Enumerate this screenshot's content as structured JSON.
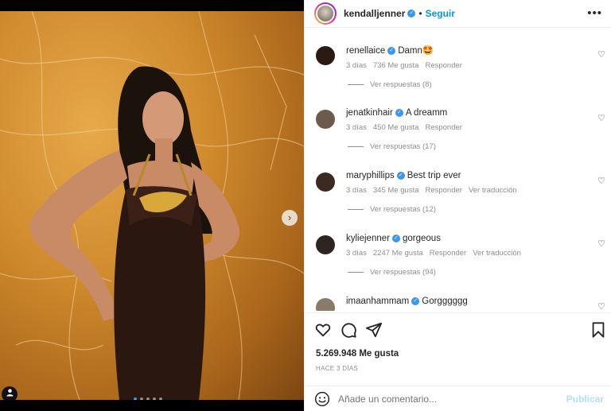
{
  "header": {
    "username": "kendalljenner",
    "separator": "•",
    "follow_label": "Seguir",
    "more_label": "•••"
  },
  "photo": {
    "next_arrow": "›",
    "user_tag_icon": "person-icon",
    "carousel_dots": 5,
    "carousel_active": 0
  },
  "comments": [
    {
      "user": "renellaice",
      "verified": true,
      "text": "Damn🤩",
      "age": "3 días",
      "likes": "736 Me gusta",
      "reply": "Responder",
      "translate": "",
      "replies": "Ver respuestas (8)",
      "avatar_color": "#2b1a14"
    },
    {
      "user": "jenatkinhair",
      "verified": true,
      "text": "A dreamm",
      "age": "3 días",
      "likes": "450 Me gusta",
      "reply": "Responder",
      "translate": "",
      "replies": "Ver respuestas (17)",
      "avatar_color": "#6d5a4d"
    },
    {
      "user": "maryphillips",
      "verified": true,
      "text": "Best trip ever",
      "age": "3 días",
      "likes": "345 Me gusta",
      "reply": "Responder",
      "translate": "Ver traducción",
      "replies": "Ver respuestas (12)",
      "avatar_color": "#3a2a22"
    },
    {
      "user": "kyliejenner",
      "verified": true,
      "text": "gorgeous",
      "age": "3 días",
      "likes": "2247 Me gusta",
      "reply": "Responder",
      "translate": "Ver traducción",
      "replies": "Ver respuestas (94)",
      "avatar_color": "#2e2420"
    },
    {
      "user": "imaanhammam",
      "verified": true,
      "text": "Gorgggggg",
      "age": "",
      "likes": "",
      "reply": "",
      "translate": "",
      "replies": "",
      "avatar_color": "#8a7a6a"
    }
  ],
  "post": {
    "likes": "5.269.948 Me gusta",
    "time_ago": "HACE 3 DÍAS"
  },
  "composer": {
    "placeholder": "Añade un comentario...",
    "publish_label": "Publicar"
  },
  "colors": {
    "accent": "#0095f6",
    "verified": "#3897f0",
    "publish_disabled": "#b2dffc",
    "muted": "#8e8e8e"
  }
}
